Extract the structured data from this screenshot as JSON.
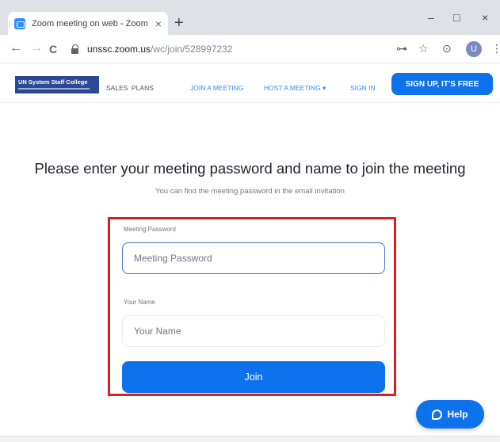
{
  "browser": {
    "tab_title": "Zoom meeting on web - Zoom",
    "tab_close": "×",
    "new_tab": "+",
    "win_minimize": "–",
    "win_maximize": "□",
    "win_close": "×",
    "back": "←",
    "forward": "→",
    "reload": "C",
    "url_host": "unssc.zoom.us",
    "url_path": "/wc/join/528997232",
    "key_icon": "⊶",
    "star_icon": "☆",
    "extension_icon": "⊙",
    "profile_initial": "U",
    "menu_icon": "⋮"
  },
  "header": {
    "logo_text": "UN System Staff College",
    "nav": {
      "sales": "SALES",
      "plans": "PLANS",
      "join": "JOIN A MEETING",
      "host": "HOST A MEETING ▾",
      "signin": "SIGN IN"
    },
    "signup": "SIGN UP, IT'S FREE"
  },
  "main": {
    "heading": "Please enter your meeting password and name to join the meeting",
    "subheading": "You can find the meeting password in the email invitation",
    "password_label": "Meeting Password",
    "password_placeholder": "Meeting Password",
    "name_label": "Your Name",
    "name_placeholder": "Your Name",
    "join_label": "Join"
  },
  "help": {
    "label": "Help"
  },
  "colors": {
    "accent": "#0e72ed",
    "highlight": "#d71f26"
  }
}
